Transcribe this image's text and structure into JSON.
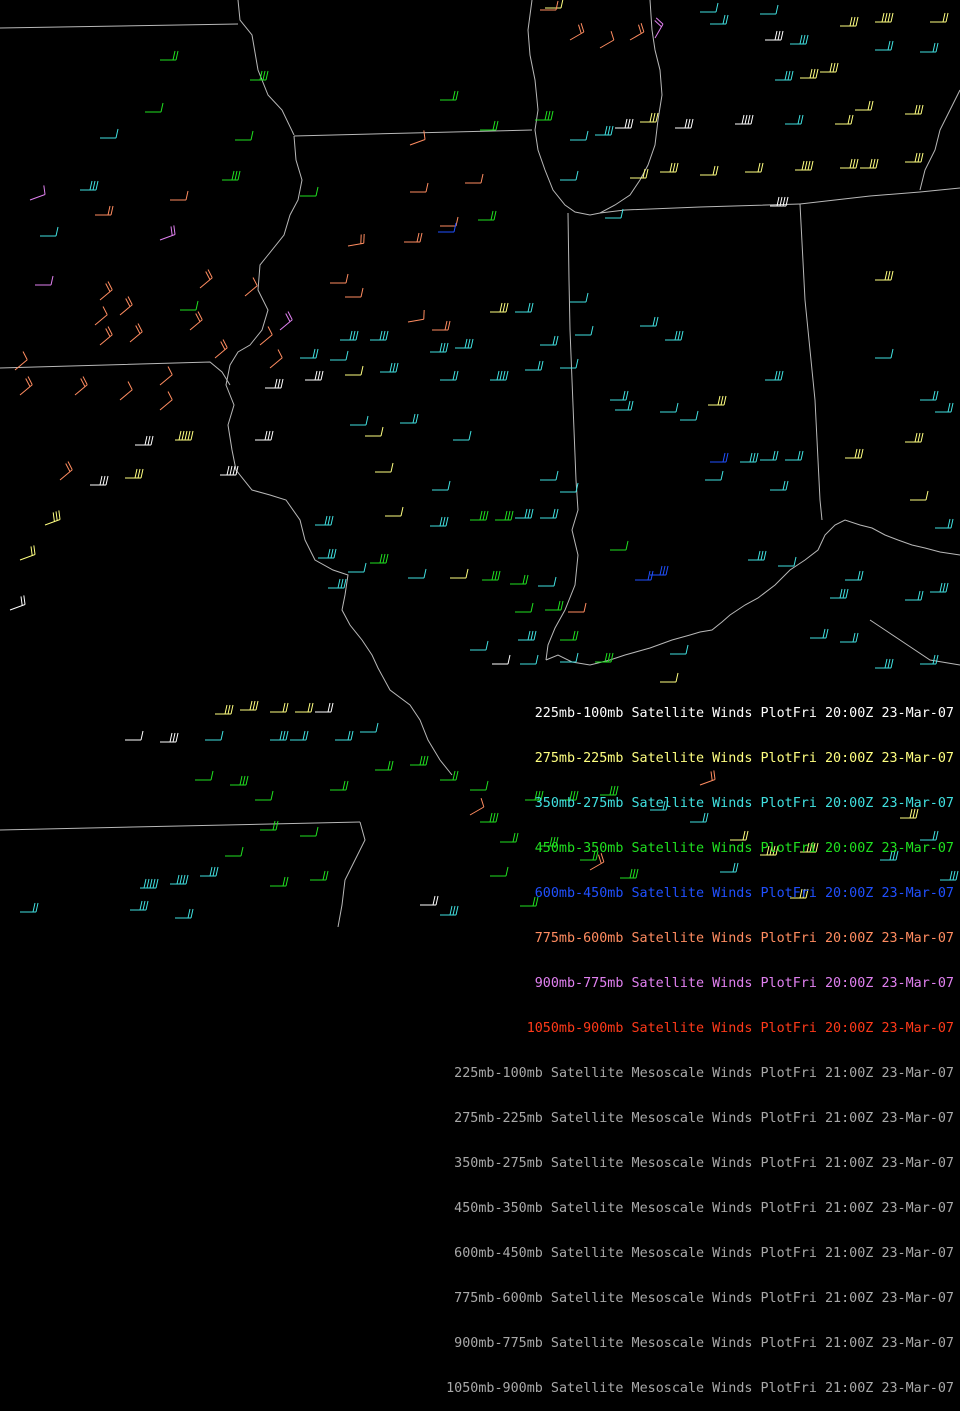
{
  "legend": [
    {
      "layers": "225mb-100mb",
      "product": "Satellite Winds Plot",
      "day": "Fri",
      "time": "20:00Z",
      "date": "23-Mar-07",
      "color": "#ffffff"
    },
    {
      "layers": "275mb-225mb",
      "product": "Satellite Winds Plot",
      "day": "Fri",
      "time": "20:00Z",
      "date": "23-Mar-07",
      "color": "#ffff80"
    },
    {
      "layers": "350mb-275mb",
      "product": "Satellite Winds Plot",
      "day": "Fri",
      "time": "20:00Z",
      "date": "23-Mar-07",
      "color": "#40e0e0"
    },
    {
      "layers": "450mb-350mb",
      "product": "Satellite Winds Plot",
      "day": "Fri",
      "time": "20:00Z",
      "date": "23-Mar-07",
      "color": "#20e020"
    },
    {
      "layers": "600mb-450mb",
      "product": "Satellite Winds Plot",
      "day": "Fri",
      "time": "20:00Z",
      "date": "23-Mar-07",
      "color": "#2050ff"
    },
    {
      "layers": "775mb-600mb",
      "product": "Satellite Winds Plot",
      "day": "Fri",
      "time": "20:00Z",
      "date": "23-Mar-07",
      "color": "#ff8c60"
    },
    {
      "layers": "900mb-775mb",
      "product": "Satellite Winds Plot",
      "day": "Fri",
      "time": "20:00Z",
      "date": "23-Mar-07",
      "color": "#e080f0"
    },
    {
      "layers": "1050mb-900mb",
      "product": "Satellite Winds Plot",
      "day": "Fri",
      "time": "20:00Z",
      "date": "23-Mar-07",
      "color": "#ff3a1a"
    },
    {
      "layers": "225mb-100mb",
      "product": "Satellite Mesoscale Winds Plot",
      "day": "Fri",
      "time": "21:00Z",
      "date": "23-Mar-07",
      "color": "#a8a8a8"
    },
    {
      "layers": "275mb-225mb",
      "product": "Satellite Mesoscale Winds Plot",
      "day": "Fri",
      "time": "21:00Z",
      "date": "23-Mar-07",
      "color": "#a8a8a8"
    },
    {
      "layers": "350mb-275mb",
      "product": "Satellite Mesoscale Winds Plot",
      "day": "Fri",
      "time": "21:00Z",
      "date": "23-Mar-07",
      "color": "#a8a8a8"
    },
    {
      "layers": "450mb-350mb",
      "product": "Satellite Mesoscale Winds Plot",
      "day": "Fri",
      "time": "21:00Z",
      "date": "23-Mar-07",
      "color": "#a8a8a8"
    },
    {
      "layers": "600mb-450mb",
      "product": "Satellite Mesoscale Winds Plot",
      "day": "Fri",
      "time": "21:00Z",
      "date": "23-Mar-07",
      "color": "#a8a8a8"
    },
    {
      "layers": "775mb-600mb",
      "product": "Satellite Mesoscale Winds Plot",
      "day": "Fri",
      "time": "21:00Z",
      "date": "23-Mar-07",
      "color": "#a8a8a8"
    },
    {
      "layers": "900mb-775mb",
      "product": "Satellite Mesoscale Winds Plot",
      "day": "Fri",
      "time": "21:00Z",
      "date": "23-Mar-07",
      "color": "#a8a8a8"
    },
    {
      "layers": "1050mb-900mb",
      "product": "Satellite Mesoscale Winds Plot",
      "day": "Fri",
      "time": "21:00Z",
      "date": "23-Mar-07",
      "color": "#a8a8a8"
    }
  ],
  "colors": {
    "background": "#000000",
    "borders": "#b8b8b8"
  }
}
